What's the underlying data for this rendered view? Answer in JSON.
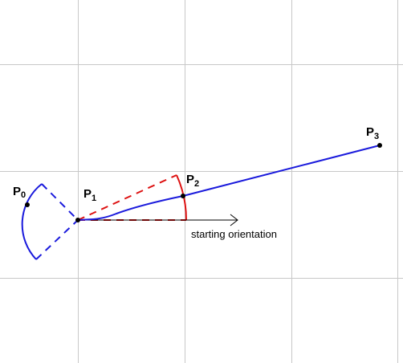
{
  "colors": {
    "grid": "#c8c8c8",
    "path": "#1a1adc",
    "construction": "#dd1111",
    "ink": "#000000"
  },
  "labels": {
    "p0": {
      "main": "P",
      "sub": "0"
    },
    "p1": {
      "main": "P",
      "sub": "1"
    },
    "p2": {
      "main": "P",
      "sub": "2"
    },
    "p3": {
      "main": "P",
      "sub": "3"
    }
  },
  "annotation": {
    "starting_orientation": "starting orientation"
  }
}
